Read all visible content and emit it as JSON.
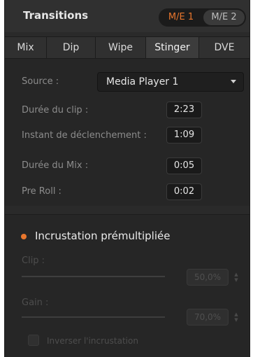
{
  "header": {
    "title": "Transitions",
    "me_buttons": [
      "M/E 1",
      "M/E 2"
    ]
  },
  "tabs": [
    {
      "label": "Mix"
    },
    {
      "label": "Dip"
    },
    {
      "label": "Wipe"
    },
    {
      "label": "Stinger",
      "active": true
    },
    {
      "label": "DVE"
    }
  ],
  "stinger": {
    "source_label": "Source :",
    "source_value": "Media Player 1",
    "clip_duration_label": "Durée du clip :",
    "clip_duration_value": "2:23",
    "trigger_label": "Instant de déclenchement :",
    "trigger_value": "1:09",
    "mix_duration_label": "Durée du Mix :",
    "mix_duration_value": "0:05",
    "preroll_label": "Pre Roll :",
    "preroll_value": "0:02"
  },
  "key": {
    "premultiplied_label": "Incrustation prémultipliée",
    "clip_label": "Clip :",
    "clip_value": "50,0%",
    "gain_label": "Gain :",
    "gain_value": "70,0%",
    "invert_label": "Inverser l'incrustation"
  },
  "colors": {
    "accent": "#e8762d",
    "panel_bg": "#2a2a2a",
    "text": "#e6e6e6",
    "muted_text": "#8c8c8c"
  }
}
